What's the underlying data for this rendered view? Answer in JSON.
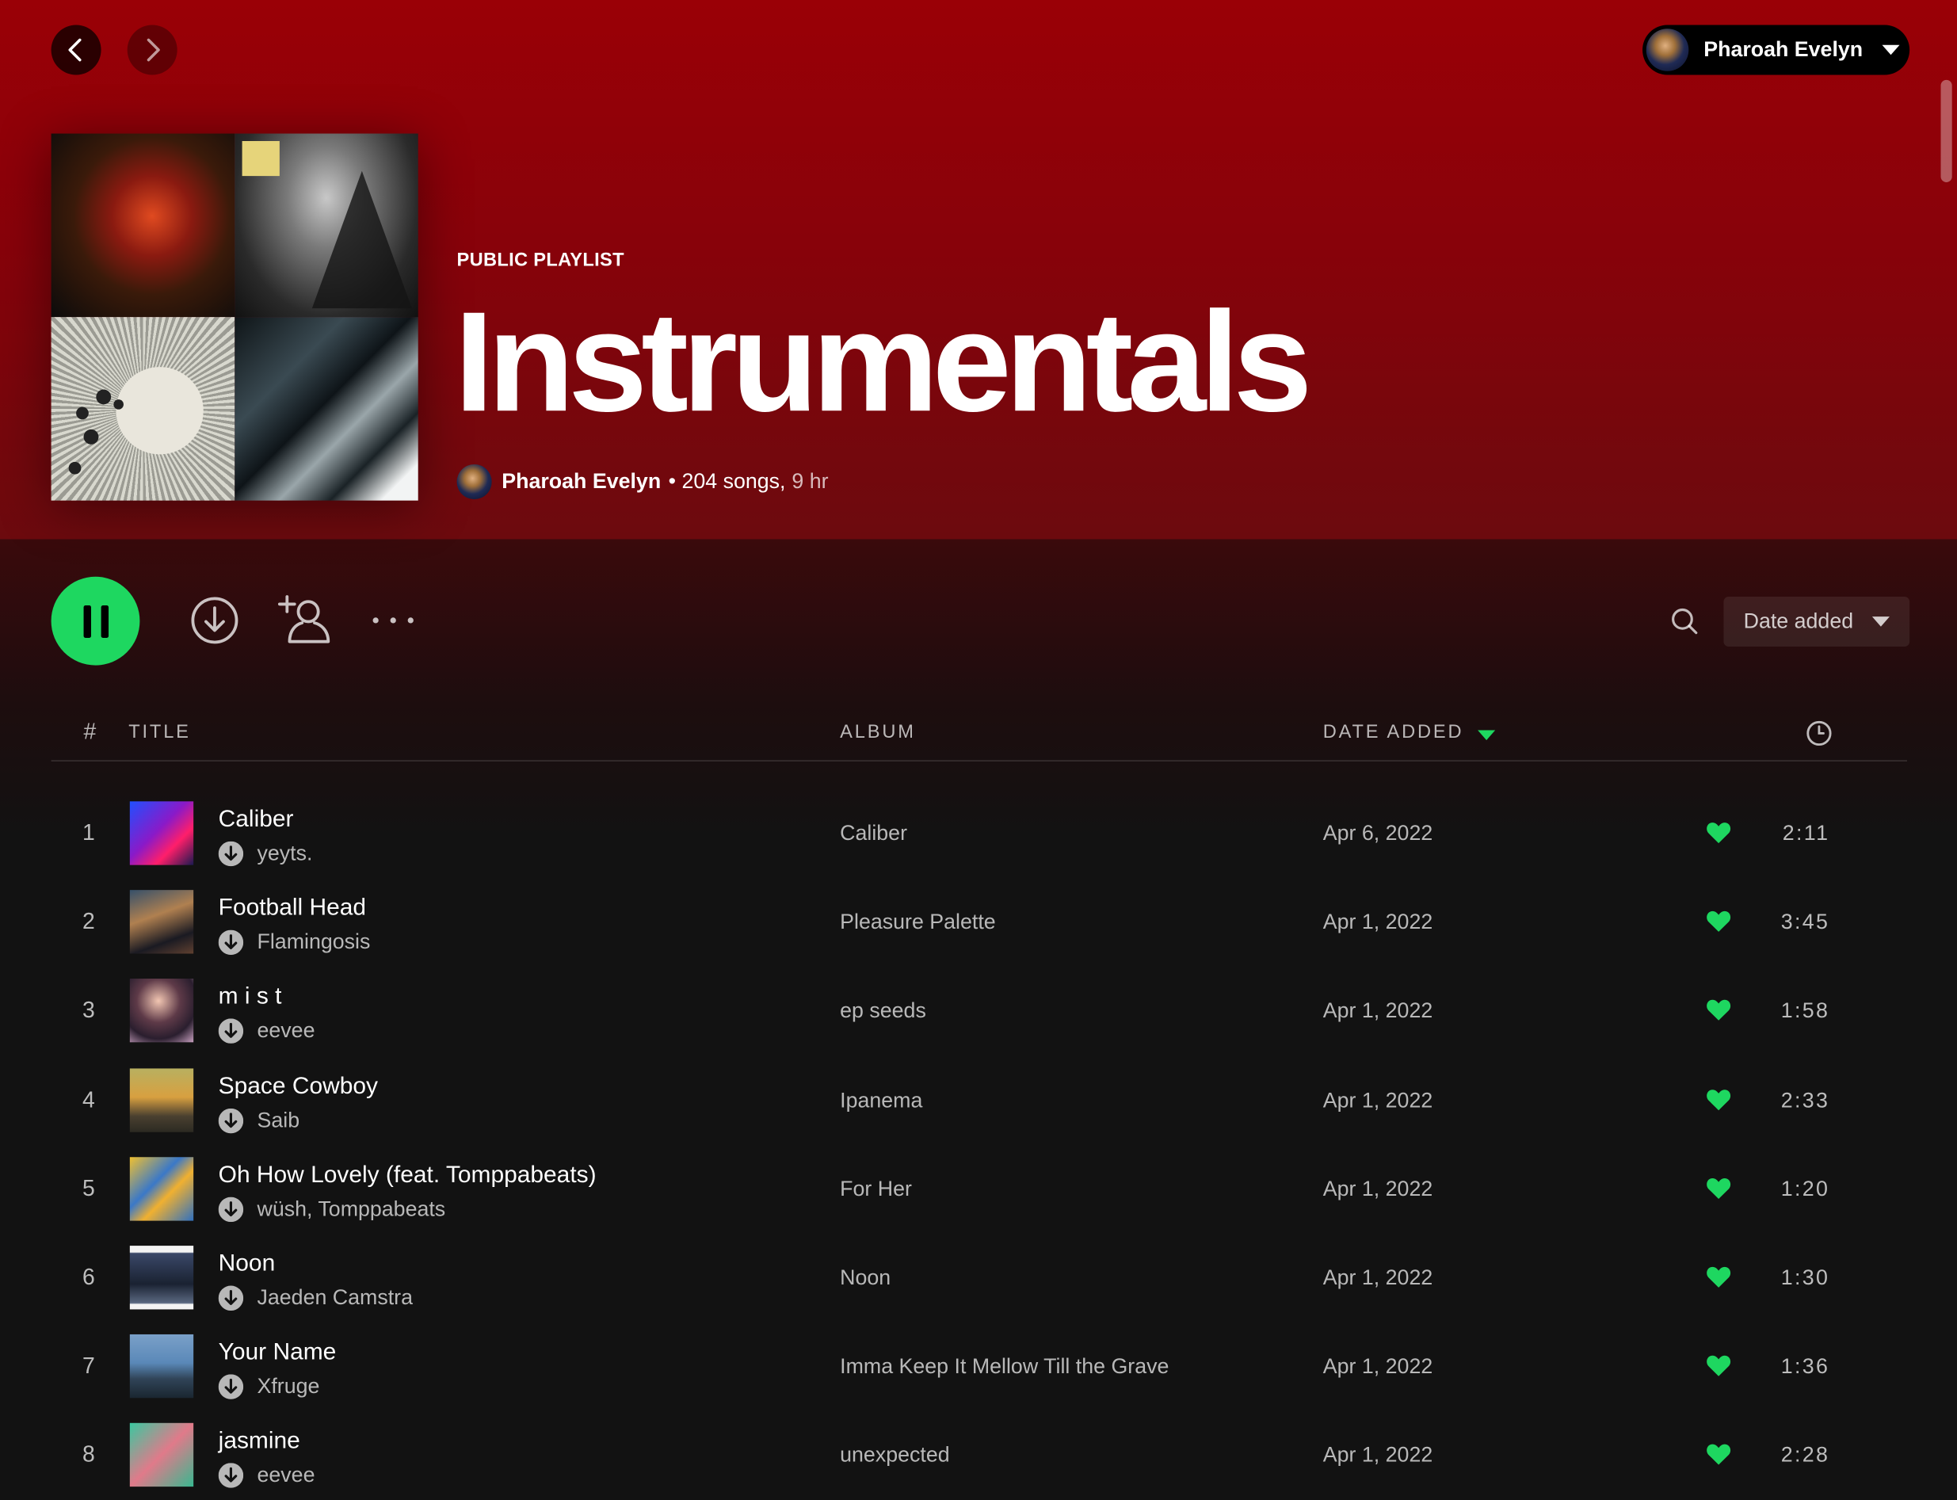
{
  "header": {
    "back_label": "Back",
    "forward_label": "Forward",
    "user_name": "Pharoah Evelyn"
  },
  "playlist": {
    "type_label": "PUBLIC PLAYLIST",
    "title": "Instrumentals",
    "owner": "Pharoah Evelyn",
    "stats": "• 204 songs,",
    "duration": "9 hr"
  },
  "controls": {
    "sort_label": "Date added"
  },
  "table": {
    "headers": {
      "index": "#",
      "title": "TITLE",
      "album": "ALBUM",
      "date_added": "DATE ADDED"
    },
    "rows": [
      {
        "index": "1",
        "title": "Caliber",
        "artist": "yeyts.",
        "album": "Caliber",
        "date_added": "Apr 6, 2022",
        "duration": "2:11",
        "liked": true
      },
      {
        "index": "2",
        "title": "Football Head",
        "artist": "Flamingosis",
        "album": "Pleasure Palette",
        "date_added": "Apr 1, 2022",
        "duration": "3:45",
        "liked": true
      },
      {
        "index": "3",
        "title": "m i s t",
        "artist": "eevee",
        "album": "ep seeds",
        "date_added": "Apr 1, 2022",
        "duration": "1:58",
        "liked": true
      },
      {
        "index": "4",
        "title": "Space Cowboy",
        "artist": "Saib",
        "album": "Ipanema",
        "date_added": "Apr 1, 2022",
        "duration": "2:33",
        "liked": true
      },
      {
        "index": "5",
        "title": "Oh How Lovely (feat. Tomppabeats)",
        "artist": "wüsh, Tomppabeats",
        "album": "For Her",
        "date_added": "Apr 1, 2022",
        "duration": "1:20",
        "liked": true
      },
      {
        "index": "6",
        "title": "Noon",
        "artist": "Jaeden Camstra",
        "album": "Noon",
        "date_added": "Apr 1, 2022",
        "duration": "1:30",
        "liked": true
      },
      {
        "index": "7",
        "title": "Your Name",
        "artist": "Xfruge",
        "album": "Imma Keep It Mellow Till the Grave",
        "date_added": "Apr 1, 2022",
        "duration": "1:36",
        "liked": true
      },
      {
        "index": "8",
        "title": "jasmine",
        "artist": "eevee",
        "album": "unexpected",
        "date_added": "Apr 1, 2022",
        "duration": "2:28",
        "liked": true
      }
    ]
  },
  "colors": {
    "accent": "#1ed760",
    "hero": "#9a0006",
    "background": "#121212"
  },
  "icons": [
    "chevron-left-icon",
    "chevron-right-icon",
    "caret-down-icon",
    "pause-icon",
    "download-icon",
    "add-user-icon",
    "more-icon",
    "search-icon",
    "clock-icon",
    "heart-icon"
  ]
}
